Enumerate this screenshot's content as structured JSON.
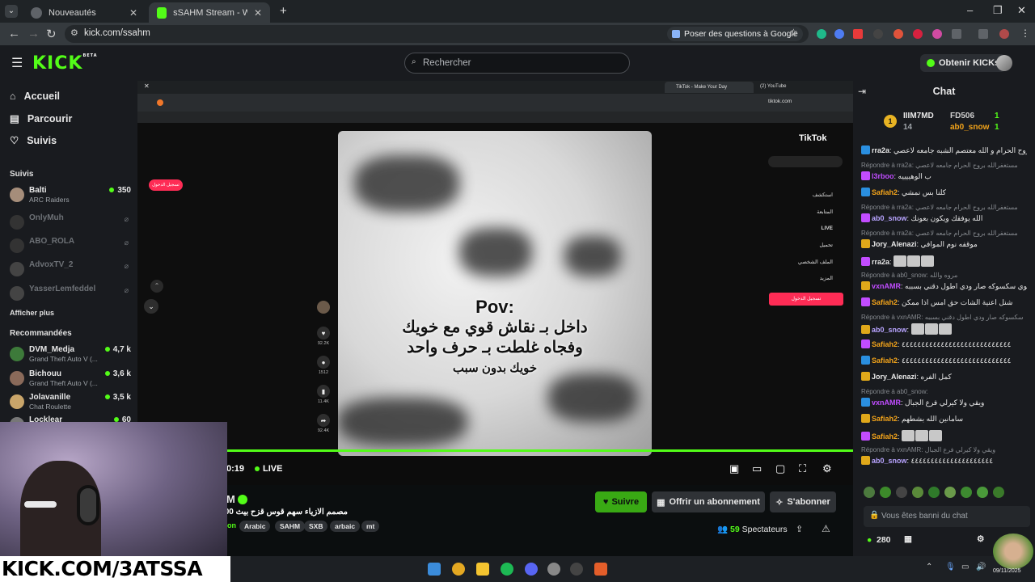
{
  "browser": {
    "tabs": [
      {
        "label": "Nouveautés",
        "active": false
      },
      {
        "label": "sSAHM Stream - Watch Live on",
        "active": true
      }
    ],
    "url": "kick.com/ssahm",
    "google_button": "Poser des questions à Google"
  },
  "header": {
    "logo": "KICK",
    "logo_badge": "BETA",
    "search_placeholder": "Rechercher",
    "get_kicks": "Obtenir KICKs"
  },
  "sidebar": {
    "nav": [
      {
        "label": "Accueil",
        "icon": "home-icon"
      },
      {
        "label": "Parcourir",
        "icon": "browse-icon"
      },
      {
        "label": "Suivis",
        "icon": "heart-icon"
      }
    ],
    "followed_title": "Suivis",
    "followed": [
      {
        "name": "Balti",
        "category": "ARC Raiders",
        "viewers": "350",
        "online": true
      },
      {
        "name": "OnlyMuh",
        "online": false
      },
      {
        "name": "ABO_ROLA",
        "online": false
      },
      {
        "name": "AdvoxTV_2",
        "online": false
      },
      {
        "name": "YasserLemfeddel",
        "online": false
      }
    ],
    "show_more": "Afficher plus",
    "recommended_title": "Recommandées",
    "recommended": [
      {
        "name": "DVM_Medja",
        "category": "Grand Theft Auto V (...",
        "viewers": "4,7 k"
      },
      {
        "name": "Bichouu",
        "category": "Grand Theft Auto V (...",
        "viewers": "3,6 k"
      },
      {
        "name": "Jolavanille",
        "category": "Chat Roulette",
        "viewers": "3,5 k"
      },
      {
        "name": "Locklear",
        "category": "",
        "viewers": "60"
      }
    ]
  },
  "video": {
    "inner_tabs": [
      "TikTok - Make Your Day",
      "(2) YouTube"
    ],
    "inner_url": "tiktok.com",
    "tiktok_logo": "TikTok",
    "overlay_pov": "Pov:",
    "overlay_line1": "داخل بـ نقاش قوي مع خويك",
    "overlay_line2": "وفجاه غلطت بـ حرف واحد",
    "overlay_line3": "خويك بدون سبب",
    "actions": [
      {
        "label": "92.2K",
        "icon": "heart-icon"
      },
      {
        "label": "1512",
        "icon": "comment-icon"
      },
      {
        "label": "11.4K",
        "icon": "bookmark-icon"
      },
      {
        "label": "92.4K",
        "icon": "share-icon"
      }
    ],
    "tt_menu": [
      "استكشف",
      "المتابعة",
      "LIVE",
      "تحميل",
      "الملف الشخصي",
      "المزيد"
    ],
    "tt_login": "تسجيل الدخول",
    "tt_login_small": "تسجيل الدخول",
    "timecode": "0:19",
    "live": "LIVE"
  },
  "stream": {
    "streamer_name": "M",
    "title": "مصمم الازياء سهم قوس قزح بيث 100 ساعة",
    "category": "on",
    "tags": [
      "Arabic",
      "SAHM",
      "SXB",
      "arbaic",
      "mt"
    ],
    "follow_label": "Suivre",
    "gift_label": "Offrir un abonnement",
    "subscribe_label": "S'abonner",
    "viewers": "59",
    "viewers_label": "Spectateurs"
  },
  "chat": {
    "title": "Chat",
    "leaderboard": [
      {
        "name": "IIIM7MD",
        "count": "14",
        "rank": "1"
      },
      {
        "name": "FD506",
        "count": "1"
      },
      {
        "name": "ab0_snow",
        "count": "1"
      }
    ],
    "messages": [
      {
        "type": "msg",
        "user": "rra2a",
        "color": "#e8e8e8",
        "text": "يمممممممممم استغفرالله بروح الحرام و الله معتصم الشبه جامعه لاعصي"
      },
      {
        "type": "reply",
        "text": "Répondre à rra2a: مستغفرالله بروح الحرام جامعه لاعصي"
      },
      {
        "type": "msg",
        "user": "l3rboo",
        "color": "#c04cff",
        "text": "ب الوهييييه"
      },
      {
        "type": "msg",
        "user": "Safiah2",
        "color": "#f2a31a",
        "text": "كلنا بس نمشي"
      },
      {
        "type": "reply",
        "text": "Répondre à rra2a: مستغفرالله بروح الحرام جامعه لاعصي"
      },
      {
        "type": "msg",
        "user": "ab0_snow",
        "color": "#b8a4ff",
        "text": "الله يوفقك ويكون بعونك"
      },
      {
        "type": "reply",
        "text": "Répondre à rra2a: مستغفرالله بروح الحرام جامعه لاعصي"
      },
      {
        "type": "msg",
        "user": "Jory_Alenazi",
        "color": "#e8e8e8",
        "text": "موقفه نوم الموافي"
      },
      {
        "type": "msg",
        "user": "rra2a",
        "color": "#e8e8e8",
        "text": ""
      },
      {
        "type": "reply",
        "text": "Répondre à ab0_snow: مروه والله"
      },
      {
        "type": "msg",
        "user": "vxnAMR",
        "color": "#c04cff",
        "text": "اسوي سكسوكه صار ودي اطول دقني بسببه"
      },
      {
        "type": "msg",
        "user": "Safiah2",
        "color": "#f2a31a",
        "text": "شنل اعنية الشات حق امس اذا ممكن"
      },
      {
        "type": "reply",
        "text": "Répondre à vxnAMR: سكسوكه صار ودي اطول دقني بسببه"
      },
      {
        "type": "msg",
        "user": "ab0_snow",
        "color": "#b8a4ff",
        "text": ""
      },
      {
        "type": "msg",
        "user": "Safiah2",
        "color": "#f2a31a",
        "text": "٤٤٤٤٤٤٤٤٤٤٤٤٤٤٤٤٤٤٤٤٤٤٤٤٤٤٤٤"
      },
      {
        "type": "msg",
        "user": "Safiah2",
        "color": "#f2a31a",
        "text": "٤٤٤٤٤٤٤٤٤٤٤٤٤٤٤٤٤٤٤٤٤٤٤٤٤٤٤٤"
      },
      {
        "type": "msg",
        "user": "Jory_Alenazi",
        "color": "#e8e8e8",
        "text": "كمل الفره"
      },
      {
        "type": "reply",
        "text": "Répondre à ab0_snow:"
      },
      {
        "type": "msg",
        "user": "vxnAMR",
        "color": "#c04cff",
        "text": "ويقي ولا كيرلي فرع الجبال"
      },
      {
        "type": "msg",
        "user": "Safiah2",
        "color": "#f2a31a",
        "text": "سامانين الله بشطهم"
      },
      {
        "type": "msg",
        "user": "Safiah2",
        "color": "#f2a31a",
        "text": ""
      },
      {
        "type": "reply",
        "text": "Répondre à vxnAMR: ويقي ولا كيرلي فرع الجبال"
      },
      {
        "type": "msg",
        "user": "ab0_snow",
        "color": "#b8a4ff",
        "text": "٤٤٤٤٤٤٤٤٤٤٤٤٤٤٤٤٤٤٤٤٤"
      }
    ],
    "banned": "Vous êtes banni du chat",
    "points": "280"
  },
  "overlay_text": "KICK.COM/3ATSSA",
  "taskbar": {
    "date": "09/11/2025"
  },
  "colors": {
    "kick_green": "#53fc18",
    "tiktok_red": "#fe2c55"
  }
}
